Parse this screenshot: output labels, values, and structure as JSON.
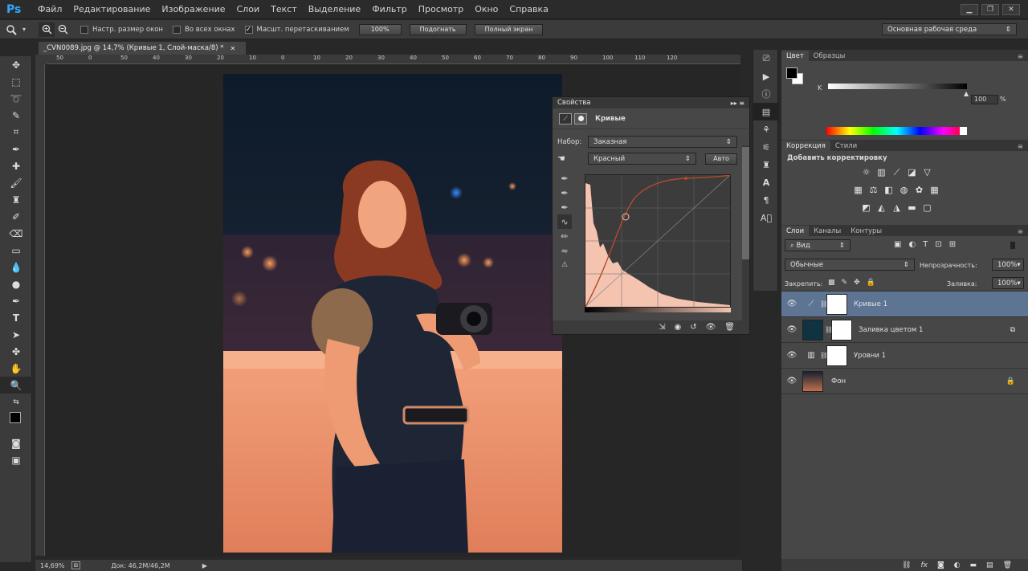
{
  "app": {
    "logo": "Ps"
  },
  "menu": [
    "Файл",
    "Редактирование",
    "Изображение",
    "Слои",
    "Текст",
    "Выделение",
    "Фильтр",
    "Просмотр",
    "Окно",
    "Справка"
  ],
  "window_controls": {
    "minimize": "▁",
    "restore": "❐",
    "close": "✕"
  },
  "options": {
    "resize_windows": "Настр. размер окон",
    "all_windows": "Во всех окнах",
    "scrubby_zoom": "Масшт. перетаскиванием",
    "zoom_100": "100%",
    "fit": "Подогнать",
    "fullscreen": "Полный экран",
    "workspace": "Основная рабочая среда"
  },
  "document": {
    "tab_title": "_CVN0089.jpg @ 14,7% (Кривые 1, Слой-маска/8) *",
    "tab_close": "✕",
    "ruler_ticks": [
      "50",
      "0",
      "50",
      "40",
      "30",
      "20",
      "10",
      "0",
      "10",
      "20",
      "30",
      "40",
      "50",
      "60",
      "70",
      "80",
      "90",
      "100",
      "110",
      "120"
    ],
    "zoom_status": "14,69%",
    "doc_status": "Док: 46,2M/46,2M"
  },
  "properties": {
    "title": "Свойства",
    "header_label": "Кривые",
    "preset_label": "Набор:",
    "preset_value": "Заказная",
    "channel_value": "Красный",
    "auto_btn": "Авто"
  },
  "color_panel": {
    "tabs": [
      "Цвет",
      "Образцы"
    ],
    "k_label": "K",
    "k_value": "100",
    "k_unit": "%",
    "k_level": 1.0
  },
  "adjustments": {
    "tabs": [
      "Коррекция",
      "Стили"
    ],
    "title": "Добавить корректировку"
  },
  "layers": {
    "tabs": [
      "Слои",
      "Каналы",
      "Контуры"
    ],
    "kind_filter": "Вид",
    "blend_mode": "Обычные",
    "opacity_label": "Непрозрачность:",
    "opacity_value": "100%",
    "lock_label": "Закрепить:",
    "fill_label": "Заливка:",
    "fill_value": "100%",
    "items": [
      {
        "name": "Кривые 1"
      },
      {
        "name": "Заливка цветом 1"
      },
      {
        "name": "Уровни 1"
      },
      {
        "name": "Фон"
      }
    ],
    "bottom_icons": [
      "link-icon",
      "fx-icon",
      "mask-icon",
      "adjustment-icon",
      "group-icon",
      "new-layer-icon",
      "trash-icon"
    ]
  },
  "colors": {
    "accent": "#31a8ff",
    "selection": "#5d7593",
    "curve": "#b44a2c"
  }
}
